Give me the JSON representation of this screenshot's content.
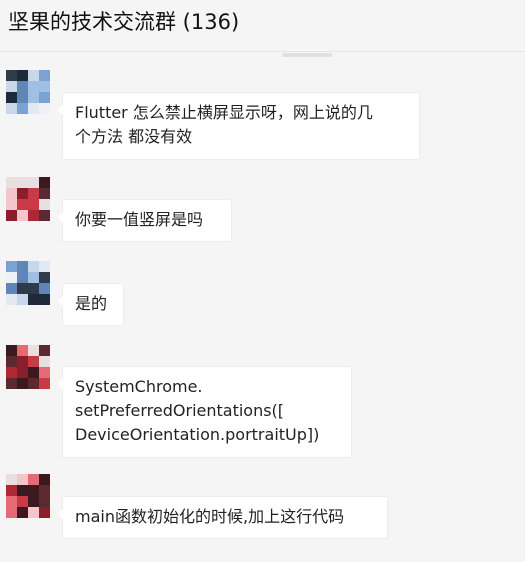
{
  "header": {
    "title": "坚果的技术交流群 (136)"
  },
  "messages": [
    {
      "avatar": "avatar-blue",
      "nick": "",
      "lines": [
        "Flutter 怎么禁止横屏显示呀，网上说的几",
        "个方法 都没有效"
      ]
    },
    {
      "avatar": "avatar-red",
      "nick": "",
      "lines": [
        "你要一值竖屏是吗"
      ]
    },
    {
      "avatar": "avatar-blue",
      "nick": "",
      "lines": [
        "是的"
      ]
    },
    {
      "avatar": "avatar-red",
      "nick": "",
      "lines": [
        "SystemChrome.",
        "setPreferredOrientations([",
        "DeviceOrientation.portraitUp])"
      ]
    },
    {
      "avatar": "avatar-red",
      "nick": "",
      "lines": [
        "main函数初始化的时候,加上这行代码"
      ]
    }
  ],
  "colors": {
    "background": "#f5f5f5",
    "bubble": "#ffffff",
    "avatar_blue": "#7da7d6",
    "avatar_red": "#c73a46"
  }
}
